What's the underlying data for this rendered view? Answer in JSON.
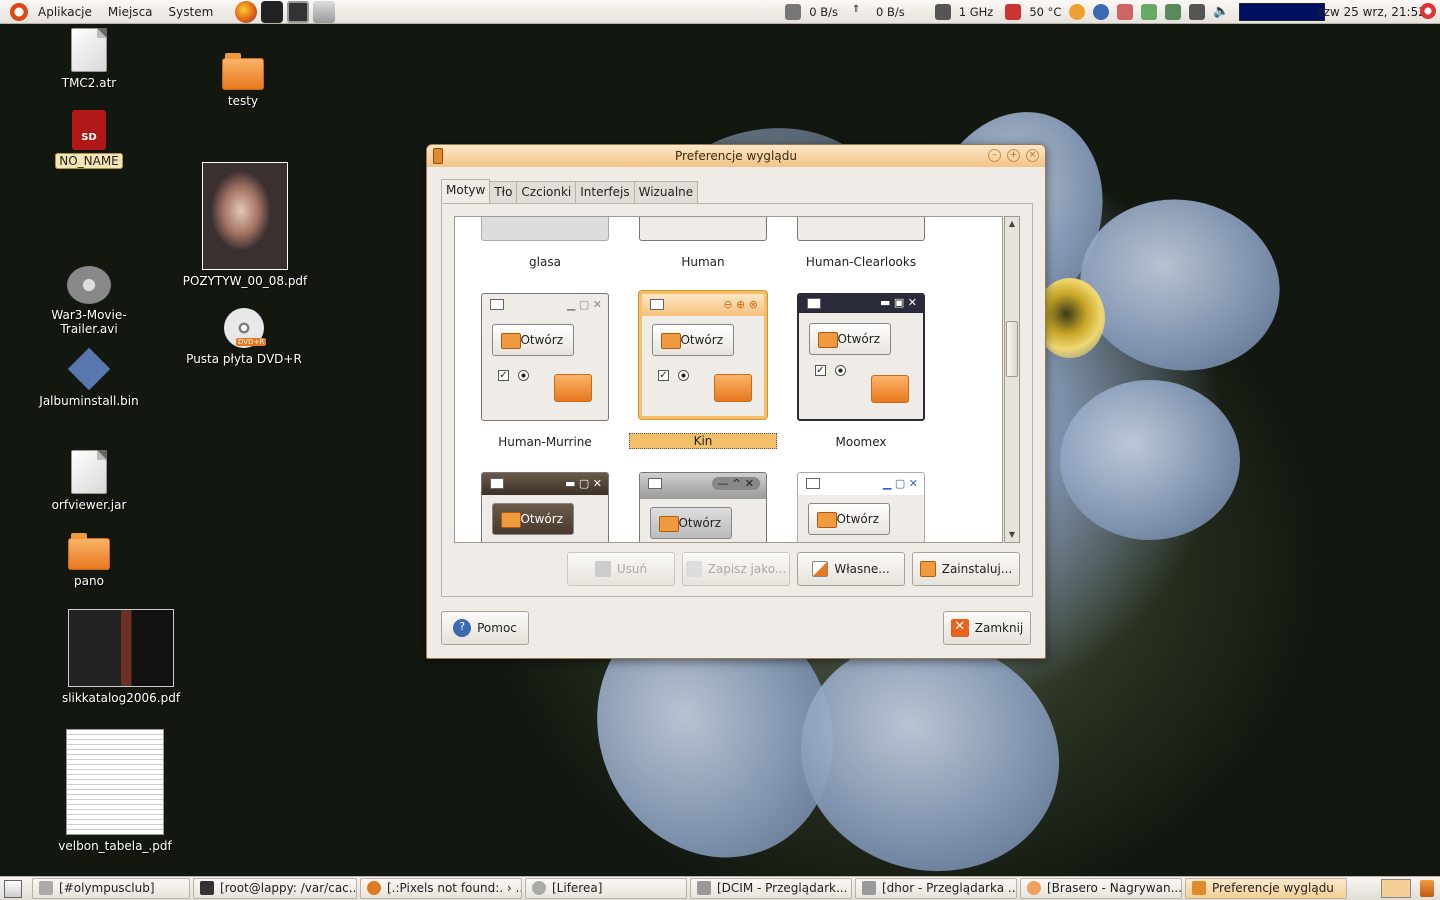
{
  "top_panel": {
    "menus": [
      "Aplikacje",
      "Miejsca",
      "System"
    ],
    "net_down": "0 B/s",
    "net_up": "0 B/s",
    "cpu_freq": "1 GHz",
    "temperature": "50 °C",
    "clock": "czw 25 wrz, 21:52"
  },
  "desktop_icons": {
    "tmc2": "TMC2.atr",
    "no_name": "NO_NAME",
    "sd_text": "SD",
    "testy": "testy",
    "pozytyw": "POZYTYW_00_08.pdf",
    "war3": "War3-Movie-Trailer.avi",
    "dvd": "Pusta płyta DVD+R",
    "dvd_badge": "DVD+R",
    "jalbum": "Jalbuminstall.bin",
    "orfviewer": "orfviewer.jar",
    "pano": "pano",
    "slik": "slikkatalog2006.pdf",
    "velbon": "velbon_tabela_.pdf"
  },
  "window": {
    "title": "Preferencje wyglądu",
    "tabs": [
      "Motyw",
      "Tło",
      "Czcionki",
      "Interfejs",
      "Wizualne"
    ],
    "themes_row1": [
      "glasa",
      "Human",
      "Human-Clearlooks"
    ],
    "themes_row2": [
      "Human-Murrine",
      "Kin",
      "Moomex"
    ],
    "preview_button": "Otwórz",
    "buttons": {
      "remove": "Usuń",
      "save_as": "Zapisz jako...",
      "custom": "Własne...",
      "install": "Zainstaluj..."
    },
    "help": "Pomoc",
    "close": "Zamknij"
  },
  "taskbar": {
    "tasks": [
      "[#olympusclub]",
      "[root@lappy: /var/cac...",
      "[.:Pixels not found:. › ...",
      "[Liferea]",
      "[DCIM - Przeglądark...",
      "[dhor - Przeglądarka ...",
      "[Brasero - Nagrywan...",
      "Preferencje wyglądu"
    ]
  }
}
